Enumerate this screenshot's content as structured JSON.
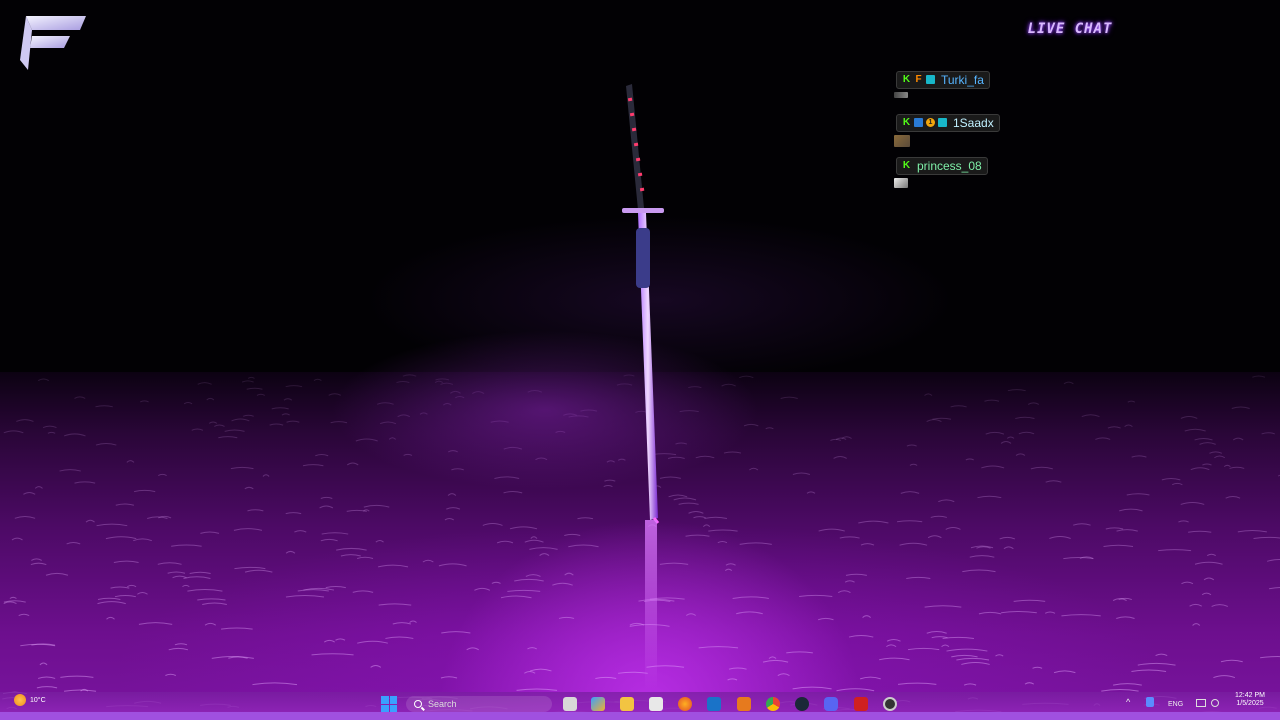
{
  "stream_overlay": {
    "live_chat_title": "LIVE CHAT",
    "messages": [
      {
        "username": "Turki_fa",
        "username_color": "#56b4ff",
        "badges": [
          "kick-badge",
          "f-badge",
          "grid-badge"
        ]
      },
      {
        "username": "1Saadx",
        "username_color": "#c0f0ff",
        "badges": [
          "kick-badge",
          "blue-badge",
          "coin-badge",
          "grid-badge"
        ]
      },
      {
        "username": "princess_08",
        "username_color": "#7ff0a8",
        "badges": [
          "kick-badge"
        ]
      }
    ]
  },
  "taskbar": {
    "weather": "10°C",
    "search_placeholder": "Search",
    "language": "ENG",
    "time": "12:42 PM",
    "date": "1/5/2025",
    "pinned_apps": [
      "file-explorer-icon",
      "widgets-icon",
      "folder-icon",
      "store-icon",
      "firefox-icon",
      "outlook-icon",
      "app-icon",
      "chrome-icon",
      "steam-icon",
      "discord-icon",
      "app-red-icon",
      "app-circle-icon"
    ]
  },
  "colors": {
    "accent": "#a050e0",
    "water": "#7a14a0",
    "chat_title": "#d9b8ff"
  }
}
